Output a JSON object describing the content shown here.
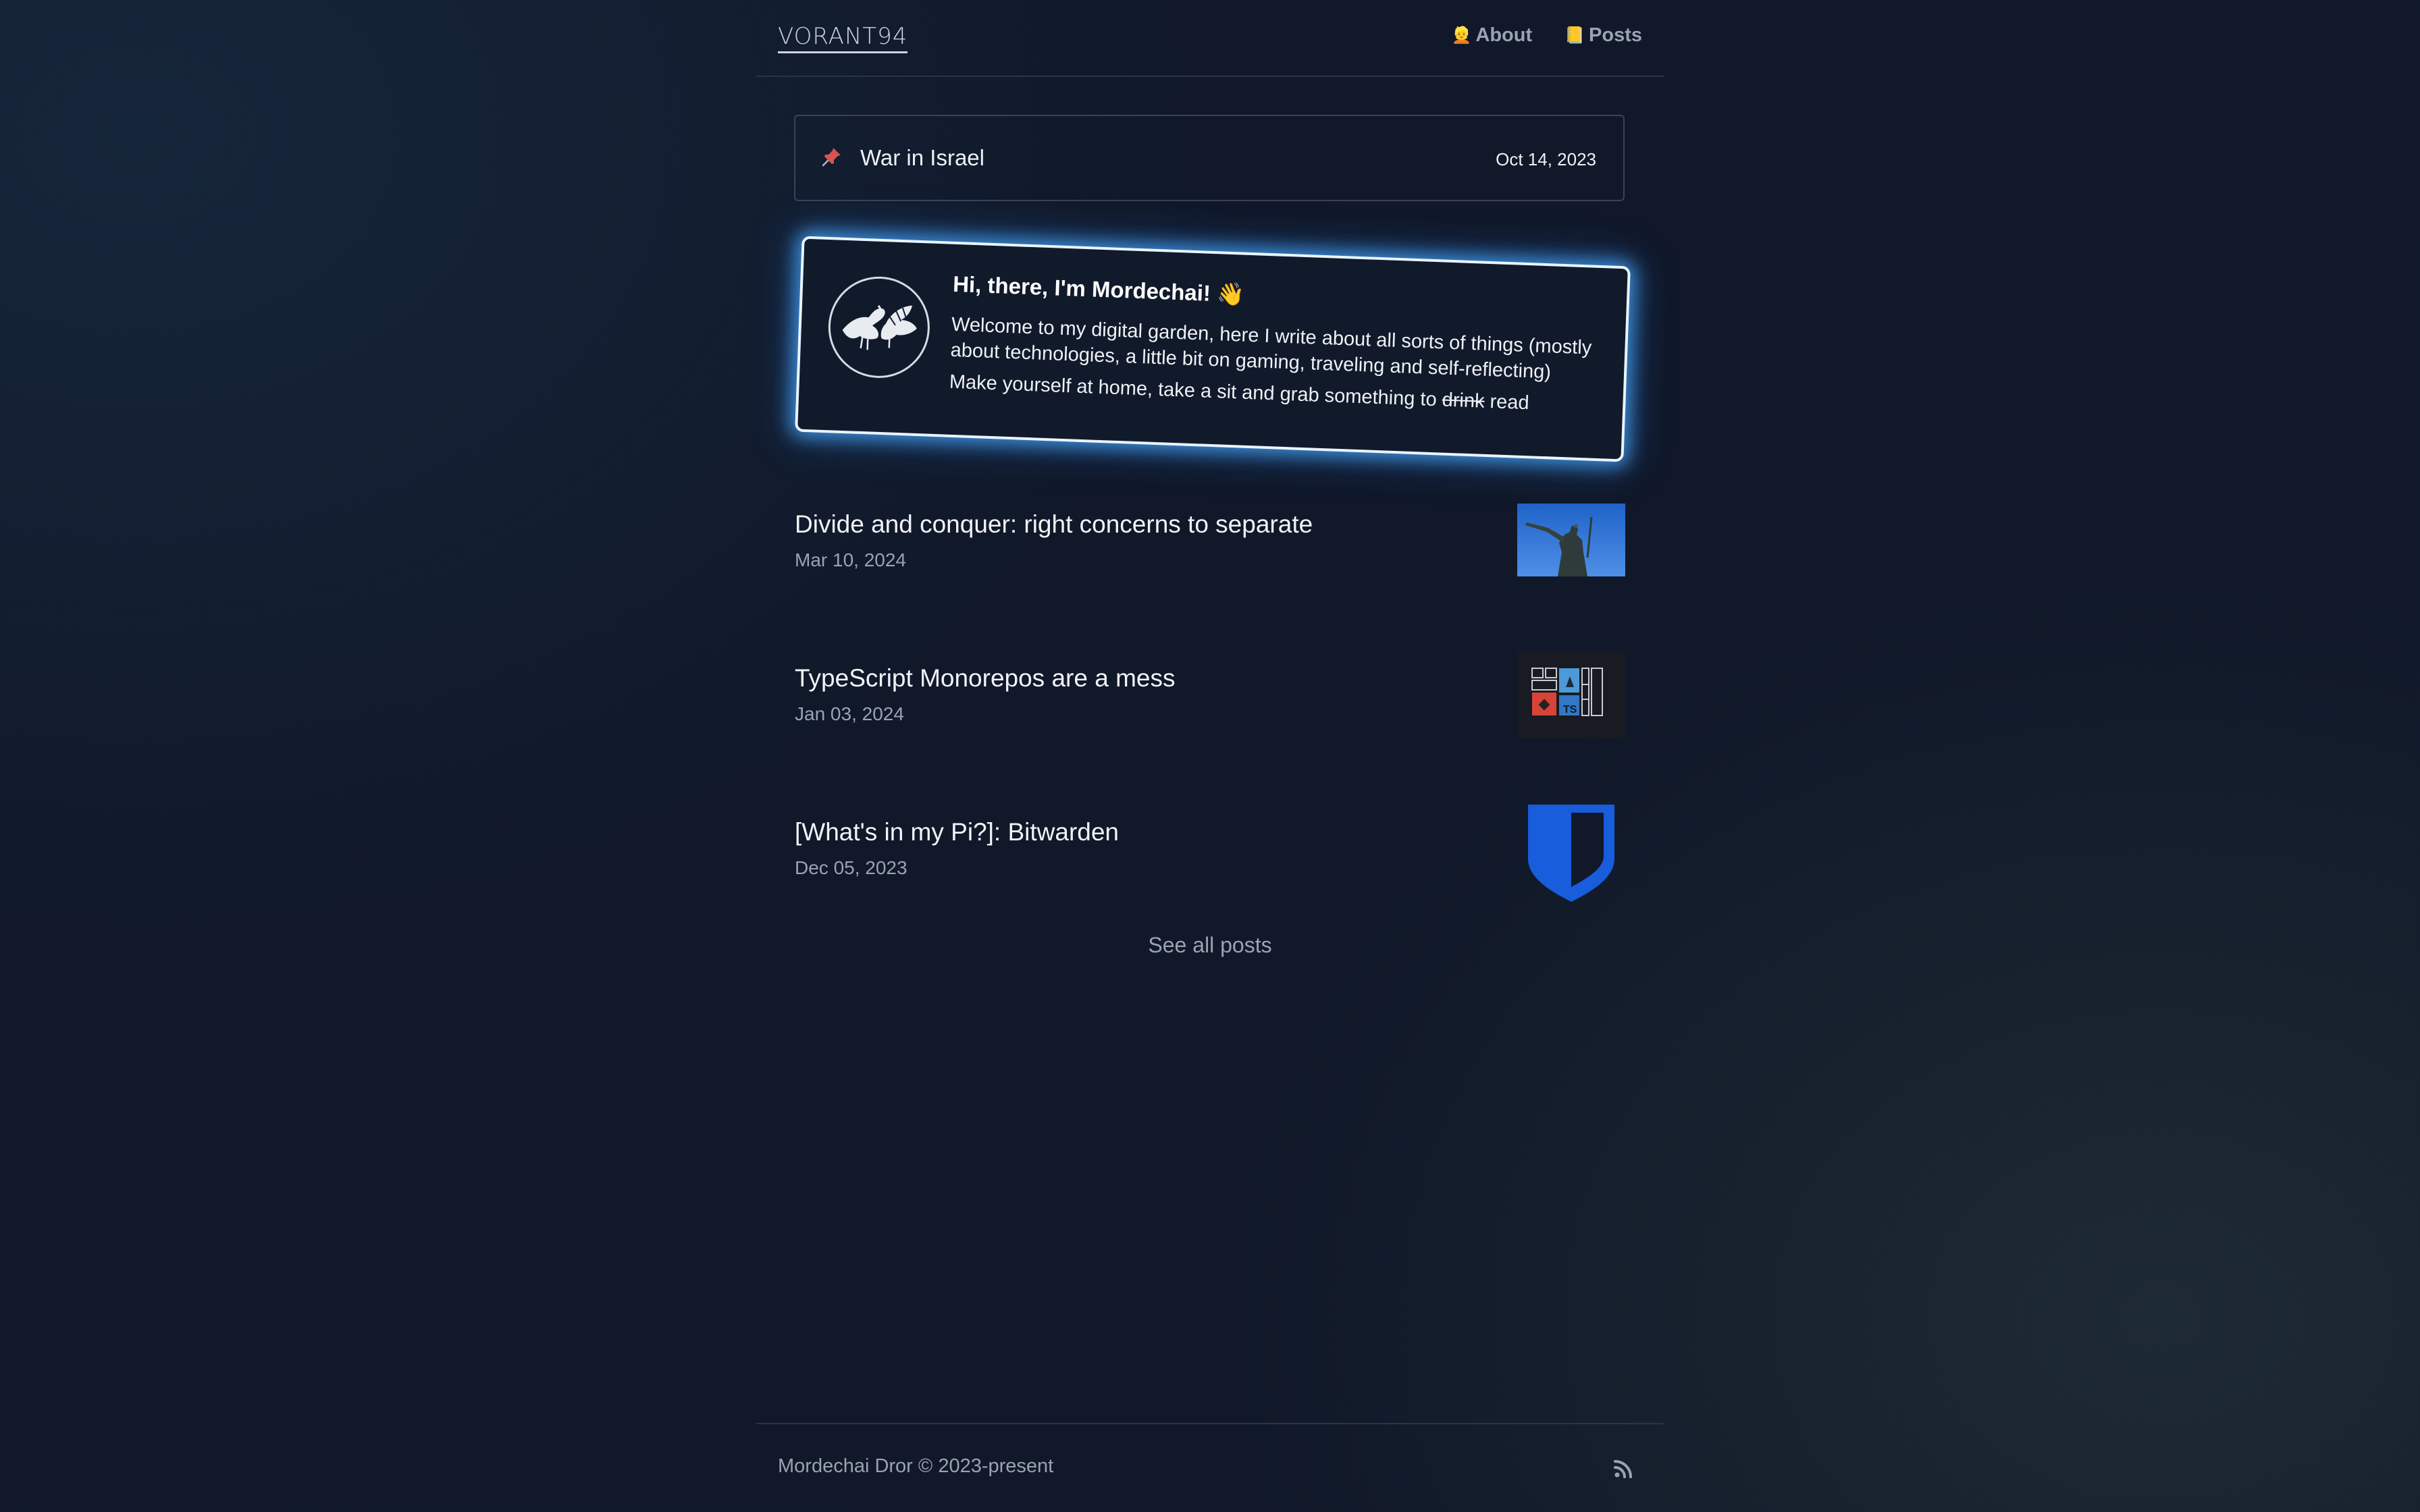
{
  "header": {
    "logo": "VORANT94",
    "nav": [
      {
        "icon": "person-icon",
        "label": "About"
      },
      {
        "icon": "notebook-icon",
        "label": "Posts"
      }
    ]
  },
  "pinned": {
    "icon": "pushpin-icon",
    "title": "War in Israel",
    "date": "Oct 14, 2023"
  },
  "intro": {
    "heading": "Hi, there, I'm Mordechai! 👋",
    "body": "Welcome to my digital garden, here I write about all sorts of things (mostly about technologies, a little bit on gaming, traveling and self-reflecting)",
    "line2_prefix": "Make yourself at home, take a sit and grab something to ",
    "line2_strike": "drink",
    "line2_suffix": " read"
  },
  "posts": [
    {
      "title": "Divide and conquer: right concerns to separate",
      "date": "Mar 10, 2024",
      "thumb": "statue-image"
    },
    {
      "title": "TypeScript Monorepos are a mess",
      "date": "Jan 03, 2024",
      "thumb": "monorepo-image"
    },
    {
      "title": "[What's in my Pi?]: Bitwarden",
      "date": "Dec 05, 2023",
      "thumb": "bitwarden-shield-icon"
    }
  ],
  "see_all": "See all posts",
  "footer": {
    "copyright": "Mordechai Dror © 2023-present",
    "rss_icon": "rss-icon"
  },
  "colors": {
    "background": "#101829",
    "glow": "#4aaaff",
    "bitwarden": "#175ddc",
    "pin": "#d9534f"
  }
}
